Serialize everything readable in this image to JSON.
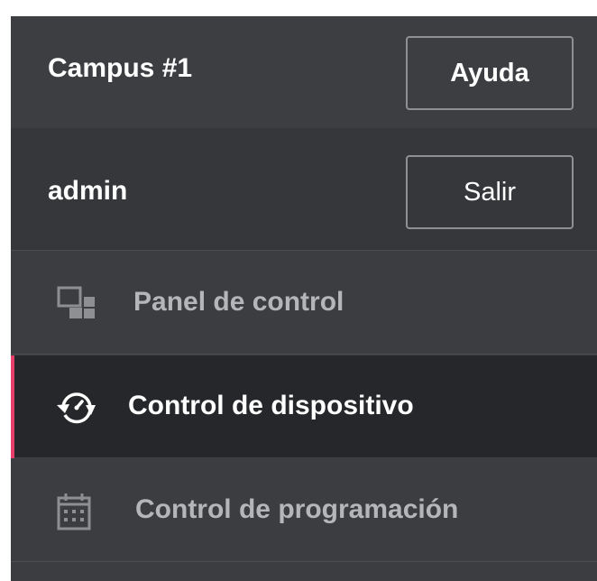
{
  "site": {
    "name": "Campus #1",
    "help_label": "Ayuda"
  },
  "user": {
    "name": "admin",
    "logout_label": "Salir"
  },
  "nav": {
    "items": [
      {
        "label": "Panel de control",
        "icon": "dashboard-icon",
        "active": false
      },
      {
        "label": "Control de dispositivo",
        "icon": "device-control-icon",
        "active": true
      },
      {
        "label": "Control de programación",
        "icon": "calendar-icon",
        "active": false
      }
    ]
  },
  "colors": {
    "sidebar_bg": "#3b3d41",
    "active_bg": "#26272a",
    "accent": "#e8406b",
    "inactive_text": "#b4b6ba",
    "active_text": "#ffffff"
  }
}
